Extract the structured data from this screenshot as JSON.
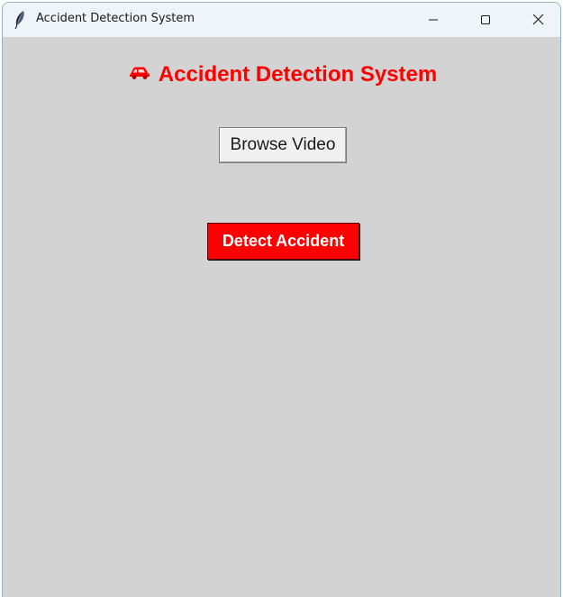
{
  "window": {
    "title": "Accident Detection System",
    "icon": "feather-icon",
    "controls": {
      "minimize": "minimize-icon",
      "maximize": "maximize-icon",
      "close": "close-icon"
    }
  },
  "app": {
    "heading_icon": "car-icon",
    "heading": "Accident Detection System",
    "browse_button_label": "Browse Video",
    "detect_button_label": "Detect Accident"
  },
  "colors": {
    "accent": "#ff0000",
    "window_background": "#d3d3d3",
    "titlebar_background": "#eff4f9",
    "detect_button_text": "#ffffff"
  }
}
